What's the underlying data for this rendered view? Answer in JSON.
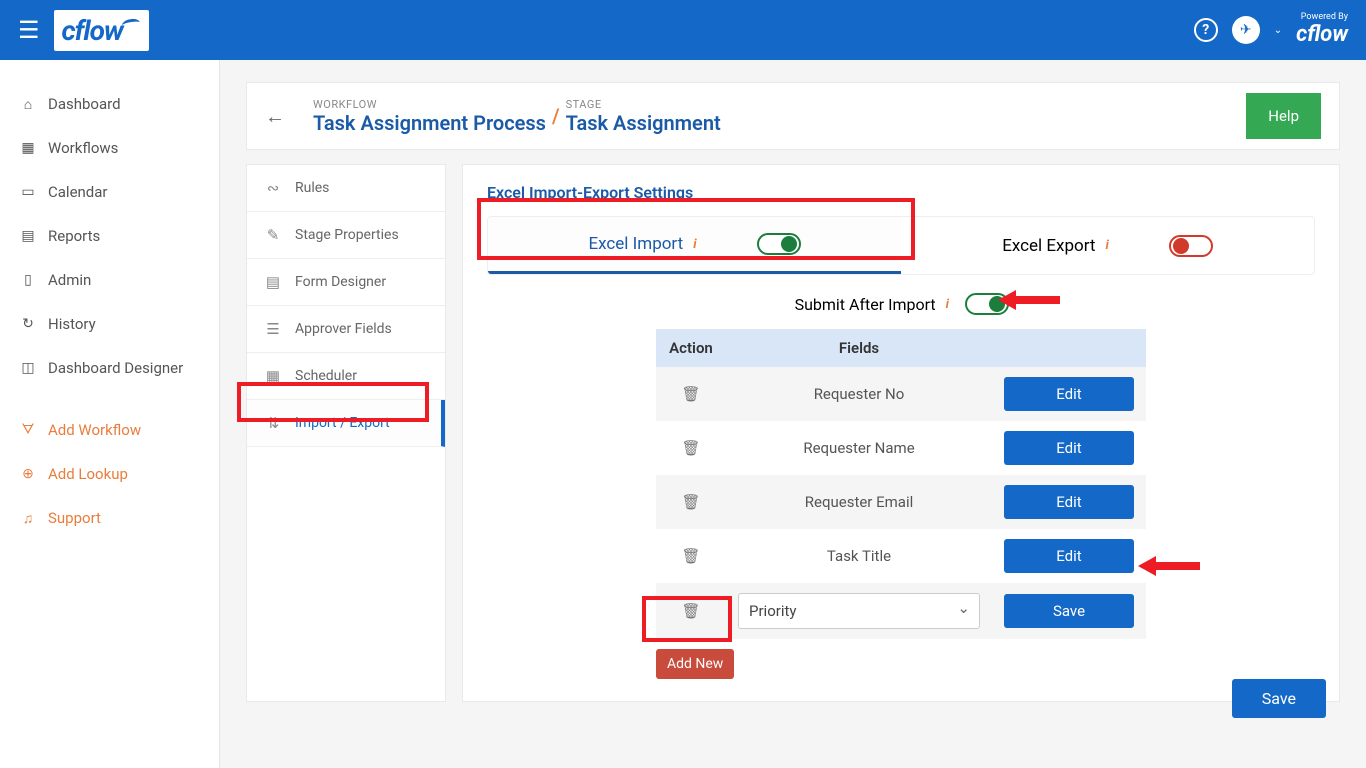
{
  "brand": "cflow",
  "powered": {
    "label": "Powered By",
    "brand": "cflow"
  },
  "nav": {
    "items": [
      {
        "label": "Dashboard"
      },
      {
        "label": "Workflows"
      },
      {
        "label": "Calendar"
      },
      {
        "label": "Reports"
      },
      {
        "label": "Admin"
      },
      {
        "label": "History"
      },
      {
        "label": "Dashboard Designer"
      }
    ],
    "accent": [
      {
        "label": "Add Workflow"
      },
      {
        "label": "Add Lookup"
      },
      {
        "label": "Support"
      }
    ]
  },
  "header": {
    "workflow_label": "WORKFLOW",
    "workflow_name": "Task Assignment Process",
    "stage_label": "STAGE",
    "stage_name": "Task Assignment",
    "help": "Help"
  },
  "side_tabs": [
    {
      "label": "Rules"
    },
    {
      "label": "Stage Properties"
    },
    {
      "label": "Form Designer"
    },
    {
      "label": "Approver Fields"
    },
    {
      "label": "Scheduler"
    },
    {
      "label": "Import / Export"
    }
  ],
  "panel": {
    "title": "Excel Import-Export Settings",
    "tabs": {
      "import": "Excel Import",
      "export": "Excel Export"
    },
    "submit_label": "Submit After Import",
    "table": {
      "headers": {
        "action": "Action",
        "fields": "Fields"
      },
      "rows": [
        {
          "field": "Requester No",
          "btn": "Edit"
        },
        {
          "field": "Requester Name",
          "btn": "Edit"
        },
        {
          "field": "Requester Email",
          "btn": "Edit"
        },
        {
          "field": "Task Title",
          "btn": "Edit"
        }
      ],
      "new_row": {
        "select_value": "Priority",
        "btn": "Save"
      }
    },
    "add_new": "Add New",
    "save": "Save"
  }
}
